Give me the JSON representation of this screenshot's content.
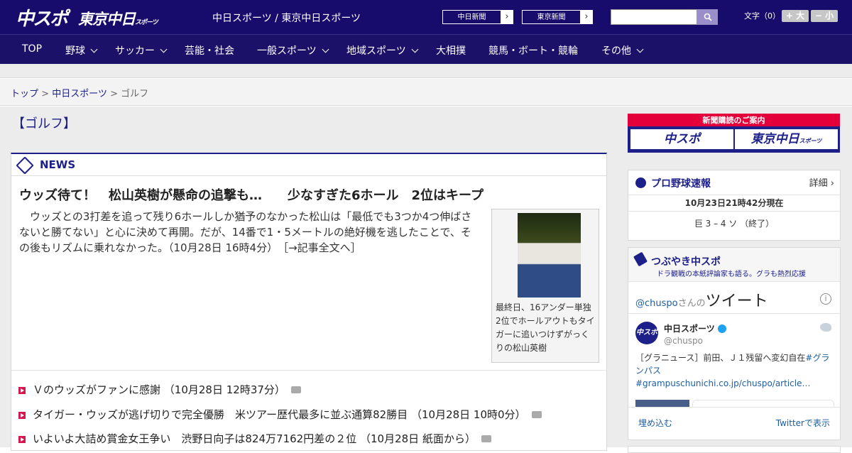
{
  "header": {
    "logo_chunichi_sports": "中スポ",
    "logo_tokyo_chunichi": "東京中日",
    "logo_tokyo_chunichi_small": "スポーツ",
    "site_title": "中日スポーツ / 東京中日スポーツ",
    "paper_links": [
      {
        "label": "中日新聞",
        "arrow": "›"
      },
      {
        "label": "東京新聞",
        "arrow": "›"
      }
    ],
    "search_placeholder": "",
    "font_size_label": "文字（0）",
    "font_larger": "+ 大",
    "font_smaller": "− 小"
  },
  "nav": {
    "items": [
      {
        "label": "TOP",
        "has_dropdown": false
      },
      {
        "label": "野球",
        "has_dropdown": true
      },
      {
        "label": "サッカー",
        "has_dropdown": true
      },
      {
        "label": "芸能・社会",
        "has_dropdown": false
      },
      {
        "label": "一般スポーツ",
        "has_dropdown": true
      },
      {
        "label": "地域スポーツ",
        "has_dropdown": true
      },
      {
        "label": "大相撲",
        "has_dropdown": false
      },
      {
        "label": "競馬・ボート・競輪",
        "has_dropdown": false
      },
      {
        "label": "その他",
        "has_dropdown": true
      }
    ]
  },
  "breadcrumb": {
    "items": [
      "トップ",
      "中日スポーツ",
      "ゴルフ"
    ],
    "separator": ">"
  },
  "page": {
    "title": "【ゴルフ】"
  },
  "news": {
    "section_label": "NEWS",
    "headline": "ウッズ待て！　松山英樹が懸命の追撃も…　　少なすぎた6ホール　2位はキープ",
    "summary": "　ウッズとの3打差を追って残り6ホールしか猶予のなかった松山は「最低でも3つか4つ伸ばさないと勝てない」と心に決めて再開。だが、14番で1・5メートルの絶好機を逃したことで、その後もリズムに乗れなかった。（10月28日 16時4分）　［→記事全文へ］",
    "photo_caption": "最終日、16アンダー単独2位でホールアウトもタイガーに追いつけずがっくりの松山英樹",
    "list": [
      {
        "title": "Ｖのウッズがファンに感謝",
        "time": "（10月28日 12時37分）"
      },
      {
        "title": "タイガー・ウッズが逃げ切りで完全優勝　米ツアー歴代最多に並ぶ通算82勝目",
        "time": "（10月28日 10時0分）"
      },
      {
        "title": "いよいよ大詰め賞金女王争い　渋野日向子は824万7162円差の２位",
        "time": "（10月28日 紙面から）"
      }
    ]
  },
  "sidebar": {
    "subscription": {
      "title": "新聞購読のご案内",
      "left": "中スポ",
      "right": "東京中日",
      "right_small": "スポーツ"
    },
    "baseball": {
      "title": "プロ野球速報",
      "more": "詳細 ›",
      "time": "10月23日21時42分現在",
      "score": "巨 3 – 4 ソ （終了）"
    },
    "tweets": {
      "title": "つぶやき中スポ",
      "subtitle": "ドラ観戦の本紙評論家も語る。グラも熱烈応援",
      "handle_prefix": "@chuspo",
      "handle_suffix": "さんの",
      "header_big": "ツイート",
      "info": "i",
      "account_name": "中日スポーツ",
      "account_handle": "@chuspo",
      "avatar_text": "中スポ",
      "tweet_text_plain": "［グラニュース］前田、Ｊ１残留へ変幻自在",
      "tweet_text_link": "#グランパス #grampuschunichi.co.jp/chuspo/article…",
      "embed": "埋め込む",
      "view_on": "Twitterで表示"
    }
  }
}
